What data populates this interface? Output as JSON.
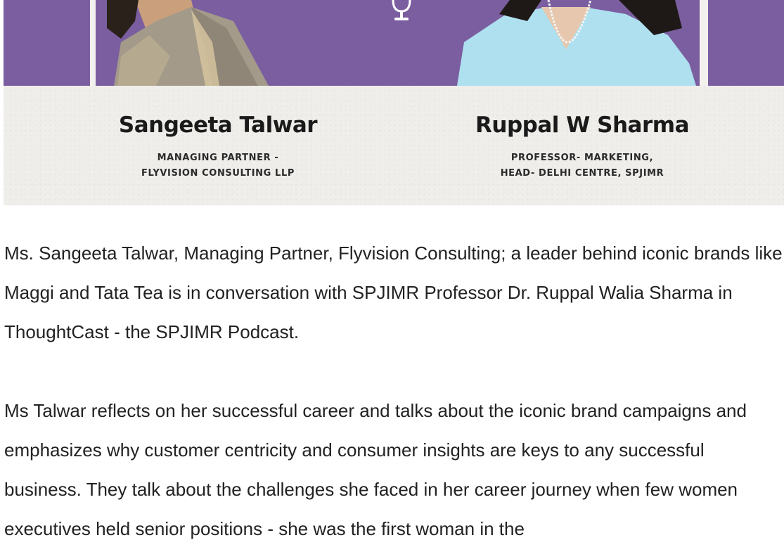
{
  "banner": {
    "purple": "#7b5ea0",
    "left_person": {
      "name": "Sangeeta Talwar",
      "role_line1": "MANAGING PARTNER -",
      "role_line2": "FLYVISION CONSULTING LLP"
    },
    "right_person": {
      "name": "Ruppal W Sharma",
      "role_line1": "PROFESSOR- MARKETING,",
      "role_line2": "HEAD- DELHI CENTRE, SPJIMR"
    },
    "center_icon": "microphone-icon"
  },
  "article": {
    "paragraph1": "Ms. Sangeeta Talwar, Managing Partner, Flyvision Consulting; a leader behind iconic brands like Maggi and Tata Tea is in conversation with SPJIMR Professor Dr. Ruppal Walia Sharma in ThoughtCast - the SPJIMR Podcast.",
    "paragraph2": "Ms Talwar reflects on her successful career and talks about the iconic brand campaigns and emphasizes why customer centricity and consumer insights are keys to any successful business. They talk about the challenges she faced in her career journey when few women executives held senior positions - she was the first woman in the"
  }
}
